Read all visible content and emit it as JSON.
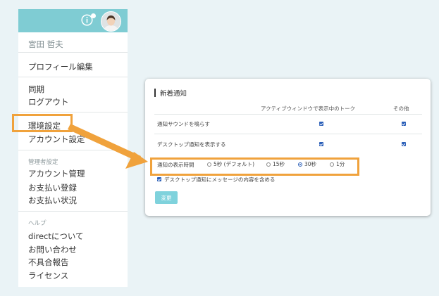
{
  "menu": {
    "user_name": "宮田 哲夫",
    "profile_edit": "プロフィール編集",
    "sync": "同期",
    "logout": "ログアウト",
    "env_settings": "環境設定",
    "account_settings": "アカウント設定",
    "admin_caption": "管理者設定",
    "account_management": "アカウント管理",
    "payment_registration": "お支払い登録",
    "payment_status": "お支払い状況",
    "help_caption": "ヘルプ",
    "about_direct": "directについて",
    "contact": "お問い合わせ",
    "bug_report": "不具合報告",
    "license": "ライセンス"
  },
  "panel": {
    "title": "新着通知",
    "col_active_window": "アクティブウィンドウで表示中のトーク",
    "col_other": "その他",
    "rows": [
      {
        "label": "通知サウンドを鳴らす",
        "active": true,
        "other": true
      },
      {
        "label": "デスクトップ通知を表示する",
        "active": true,
        "other": true
      }
    ],
    "duration_label": "通知の表示時間",
    "duration_options": [
      {
        "label": "5秒 (デフォルト)",
        "selected": false
      },
      {
        "label": "15秒",
        "selected": false
      },
      {
        "label": "30秒",
        "selected": true
      },
      {
        "label": "1分",
        "selected": false
      }
    ],
    "include_message_label": "デスクトップ通知にメッセージの内容を含める",
    "include_message_checked": true,
    "submit_label": "変更"
  },
  "colors": {
    "header": "#7fccd3",
    "highlight": "#f0a23c",
    "button": "#7fd2dc",
    "checkbox": "#2b5fb8"
  }
}
